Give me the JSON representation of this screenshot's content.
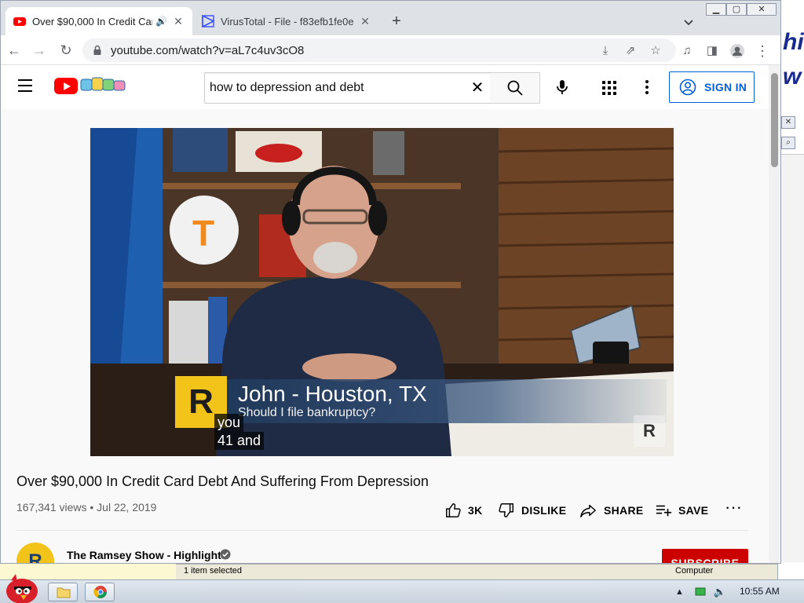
{
  "browser": {
    "tabs": [
      {
        "title": "Over $90,000 In Credit Car",
        "active": true
      },
      {
        "title": "VirusTotal - File - f83efb1fe0e",
        "active": false
      }
    ],
    "url": "youtube.com/watch?v=aL7c4uv3cO8"
  },
  "youtube": {
    "search_query": "how to depression and debt",
    "sign_in_label": "SIGN IN",
    "video": {
      "lower_third_name": "John - Houston, TX",
      "lower_third_question": "Should I file bankruptcy?",
      "captions": [
        "you",
        "41 and"
      ],
      "title": "Over $90,000 In Credit Card Debt And Suffering From Depression",
      "meta": "167,341 views • Jul 22, 2019"
    },
    "actions": {
      "like_count": "3K",
      "dislike_label": "DISLIKE",
      "share_label": "SHARE",
      "save_label": "SAVE"
    },
    "channel": {
      "name": "The Ramsey Show - Highlights",
      "subscribe_label": "SUBSCRIBE"
    }
  },
  "background_window": {
    "status_left": "1 item selected",
    "status_right": "Computer"
  },
  "taskbar": {
    "clock": "10:55 AM"
  },
  "colors": {
    "youtube_red": "#ff0000",
    "link_blue": "#065fd4",
    "subscribe_red": "#cc0000",
    "ramsey_yellow": "#f2c318"
  }
}
